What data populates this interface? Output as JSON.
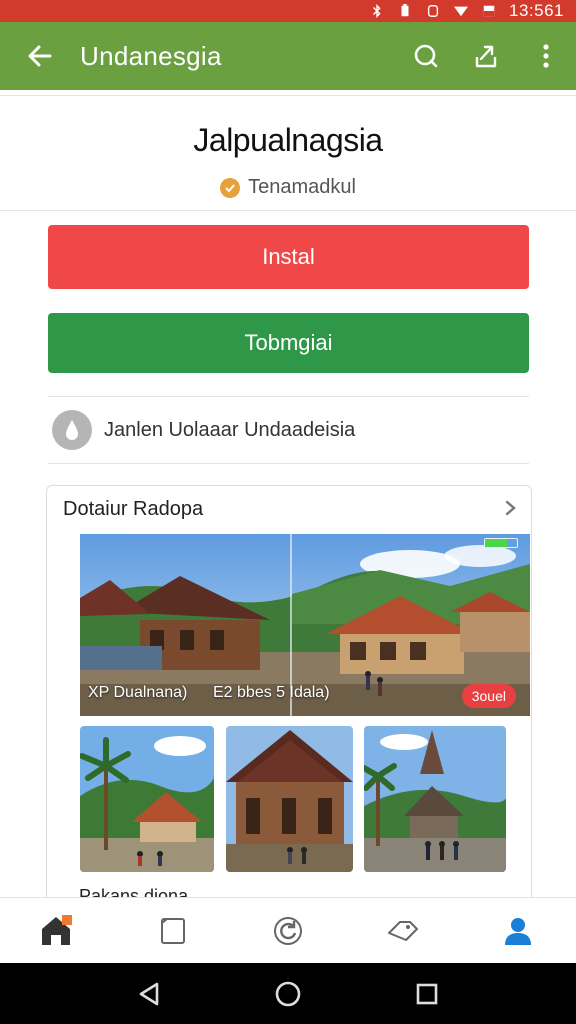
{
  "status_bar": {
    "time": "13:561"
  },
  "app_bar": {
    "title": "Undanesgia"
  },
  "app": {
    "name": "Jalpualnagsia",
    "developer": "Tenamadkul",
    "install_label": "Instal",
    "secondary_label": "Tobmgiai",
    "info_text": "Janlen Uolaaar Undaadeisia"
  },
  "screenshots": {
    "section_title": "Dotaiur Radopa",
    "caption_1": "XP Dualnana)",
    "caption_2": "E2 bbes 5 Idala)",
    "badge": "3ouel",
    "bottom_label": "Pakans diona"
  },
  "colors": {
    "status_bar": "#d23a2c",
    "app_bar": "#6aa040",
    "install": "#f04848",
    "secondary": "#2f9848",
    "nav_active": "#1a7fd6"
  },
  "bottom_nav": [
    "home-icon",
    "book-icon",
    "refresh-icon",
    "deals-icon",
    "profile-icon"
  ]
}
